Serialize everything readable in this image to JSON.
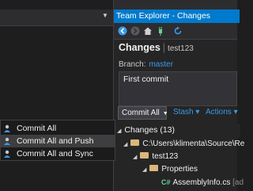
{
  "window": {
    "panel_title": "Team Explorer - Changes"
  },
  "toolbar": {
    "icons": [
      "back-arrow-icon",
      "forward-arrow-icon",
      "home-icon",
      "connect-plug-icon",
      "refresh-icon"
    ]
  },
  "changes_page": {
    "title": "Changes",
    "separator": "|",
    "repo": "test123",
    "branch_label": "Branch:",
    "branch": "master",
    "commit_message": "First commit",
    "commit_button": "Commit All",
    "stash_link": "Stash ▾",
    "actions_link": "Actions ▾"
  },
  "changes_list": {
    "header": "Changes (13)",
    "items": [
      {
        "label": "C:\\Users\\klimenta\\Source\\Re",
        "type": "folder"
      },
      {
        "label": "test123",
        "type": "folder"
      },
      {
        "label": "Properties",
        "type": "folder"
      },
      {
        "label": "AssemblyInfo.cs",
        "suffix": " [ad",
        "type": "cs-file"
      }
    ]
  },
  "commit_menu": {
    "items": [
      {
        "label": "Commit All",
        "highlighted": false
      },
      {
        "label": "Commit All and Push",
        "highlighted": true
      },
      {
        "label": "Commit All and Sync",
        "highlighted": false
      }
    ]
  },
  "colors": {
    "accent": "#007acc",
    "link": "#3a9ae8",
    "background": "#1e1e1e",
    "panel": "#252526"
  }
}
